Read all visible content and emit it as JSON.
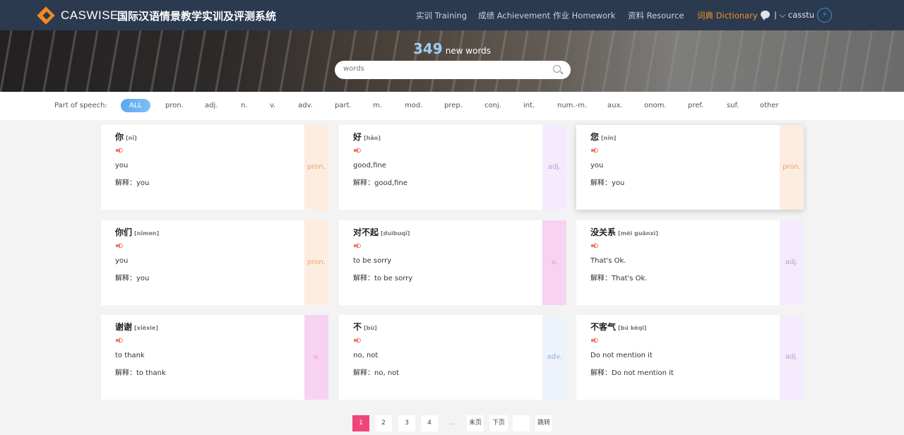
{
  "nav": {
    "logo": "CASWISE",
    "system_title": "国际汉语情景教学实训及评测系统",
    "menu": [
      "实训 Training",
      "成绩 Achievement",
      "作业 Homework",
      "资料 Resource",
      "词典 Dictionary"
    ],
    "user": "| ⌵ casstu"
  },
  "banner": {
    "count": "349",
    "count_label": "new words"
  },
  "search": {
    "placeholder": "words"
  },
  "pos_filter": {
    "label": "Part of speech:",
    "active": "ALL",
    "options": [
      "pron.",
      "adj.",
      "n.",
      "v.",
      "adv.",
      "part.",
      "m.",
      "mod.",
      "prep.",
      "conj.",
      "int.",
      "num.-m.",
      "aux.",
      "onom.",
      "pref.",
      "suf.",
      "other"
    ]
  },
  "cards": [
    {
      "word": "你",
      "pinyin": "[nǐ]",
      "meaning": "you",
      "explain": "解释：you",
      "pos": "pron."
    },
    {
      "word": "好",
      "pinyin": "[hǎo]",
      "meaning": "good,fine",
      "explain": "解释：good,fine",
      "pos": "adj."
    },
    {
      "word": "您",
      "pinyin": "[nín]",
      "meaning": "you",
      "explain": "解释：you",
      "pos": "pron."
    },
    {
      "word": "你们",
      "pinyin": "[nǐmen]",
      "meaning": "you",
      "explain": "解释：you",
      "pos": "pron."
    },
    {
      "word": "对不起",
      "pinyin": "[duìbuqǐ]",
      "meaning": "to be sorry",
      "explain": "解释：to be sorry",
      "pos": "v."
    },
    {
      "word": "没关系",
      "pinyin": "[méi guānxì]",
      "meaning": "That's Ok.",
      "explain": "解释：That's Ok.",
      "pos": "adj."
    },
    {
      "word": "谢谢",
      "pinyin": "[xièxie]",
      "meaning": "to thank",
      "explain": "解释：to thank",
      "pos": "v."
    },
    {
      "word": "不",
      "pinyin": "[bù]",
      "meaning": "no, not",
      "explain": "解释：no, not",
      "pos": "adv."
    },
    {
      "word": "不客气",
      "pinyin": "[bú kèqi]",
      "meaning": "Do not mention it",
      "explain": "解释：Do not mention it",
      "pos": "adj."
    }
  ],
  "pagination": {
    "pages": [
      "1",
      "2",
      "3",
      "4"
    ],
    "current": "1",
    "ellipsis": "...",
    "last": "末页",
    "next": "下页",
    "jump_value": "",
    "jump": "跳转"
  },
  "colors": {
    "nav_bg": "#2b3a4f",
    "accent": "#f39325",
    "active_page": "#f0457a",
    "all_pill": "#5aa8f0"
  }
}
